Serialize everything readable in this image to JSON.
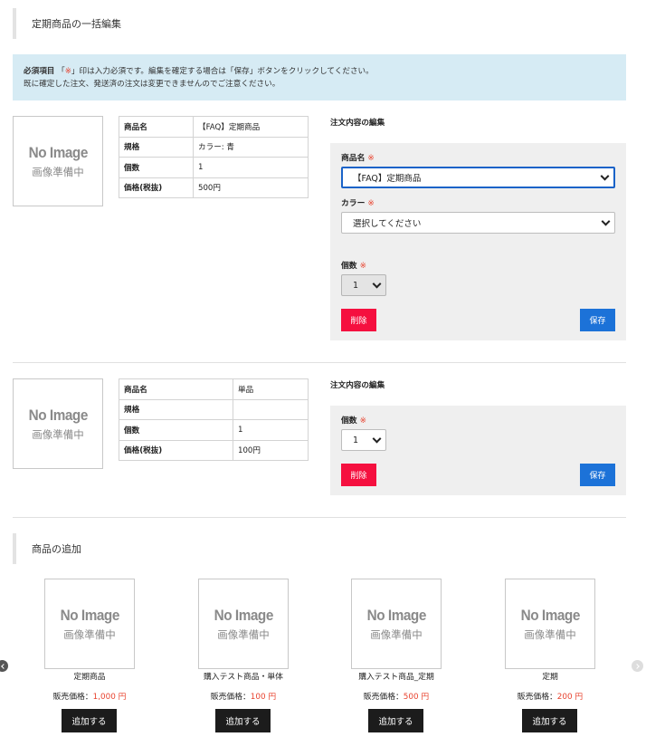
{
  "page_title": "定期商品の一括編集",
  "notice": {
    "required_label": "必須項目",
    "line1_pre": "「",
    "mark": "※",
    "line1_post": "」印は入力必須です。編集を確定する場合は「保存」ボタンをクリックしてください。",
    "line2": "既に確定した注文、発送済の注文は変更できませんのでご注意ください。"
  },
  "no_image": {
    "en": "No Image",
    "jp": "画像準備中"
  },
  "items": [
    {
      "rows": [
        {
          "key": "商品名",
          "value": "【FAQ】定期商品"
        },
        {
          "key": "規格",
          "value": "カラー: 青"
        },
        {
          "key": "個数",
          "value": "1"
        },
        {
          "key": "価格(税抜)",
          "value": "500円"
        }
      ],
      "edit_title": "注文内容の編集",
      "fields": {
        "product_label": "商品名",
        "product_value": "【FAQ】定期商品",
        "color_label": "カラー",
        "color_value": "選択してください",
        "qty_label": "個数",
        "qty_value": "1"
      },
      "required_mark": "※",
      "delete_label": "削除",
      "save_label": "保存"
    },
    {
      "rows": [
        {
          "key": "商品名",
          "value": "単品"
        },
        {
          "key": "規格",
          "value": ""
        },
        {
          "key": "個数",
          "value": "1"
        },
        {
          "key": "価格(税抜)",
          "value": "100円"
        }
      ],
      "edit_title": "注文内容の編集",
      "fields": {
        "qty_label": "個数",
        "qty_value": "1"
      },
      "required_mark": "※",
      "delete_label": "削除",
      "save_label": "保存"
    }
  ],
  "add_section": {
    "title": "商品の追加",
    "price_prefix": "販売価格：",
    "add_label": "追加する",
    "products": [
      {
        "name": "定期商品",
        "price": "1,000 円"
      },
      {
        "name": "購入テスト商品・単体",
        "price": "100 円"
      },
      {
        "name": "購入テスト商品_定期",
        "price": "500 円"
      },
      {
        "name": "定期",
        "price": "200 円"
      }
    ]
  },
  "colors": {
    "accent": "#1c72d8",
    "danger": "#f5103f",
    "required": "#e8432f",
    "notice_bg": "#d6ebf4"
  }
}
